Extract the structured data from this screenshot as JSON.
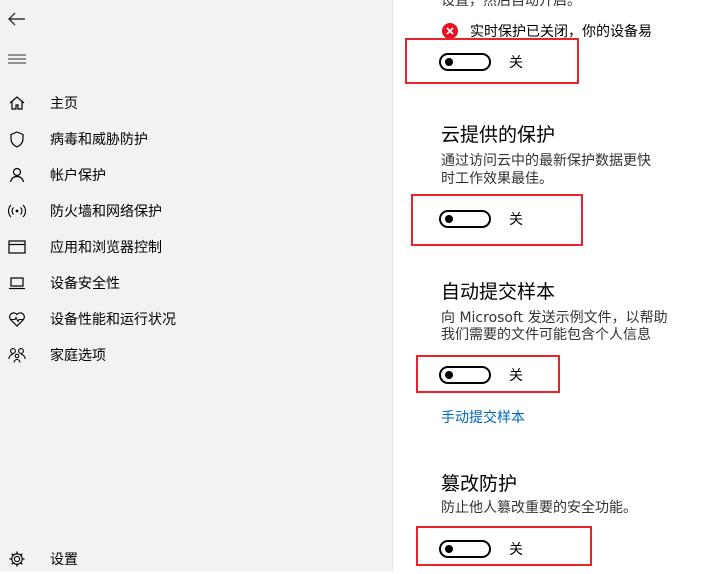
{
  "nav": {
    "items": [
      {
        "icon": "home-icon",
        "label": "主页"
      },
      {
        "icon": "shield-icon",
        "label": "病毒和威胁防护"
      },
      {
        "icon": "person-icon",
        "label": "帐户保护"
      },
      {
        "icon": "network-icon",
        "label": "防火墙和网络保护"
      },
      {
        "icon": "app-browser-icon",
        "label": "应用和浏览器控制"
      },
      {
        "icon": "laptop-icon",
        "label": "设备安全性"
      },
      {
        "icon": "heart-icon",
        "label": "设备性能和运行状况"
      },
      {
        "icon": "family-icon",
        "label": "家庭选项"
      }
    ],
    "settings_label": "设置"
  },
  "main": {
    "top_cut_text": "设置，然后自动开启。",
    "realtime": {
      "status_text": "实时保护已关闭，你的设备易",
      "toggle_label": "关"
    },
    "cloud": {
      "title": "云提供的保护",
      "desc_line1": "通过访问云中的最新保护数据更快",
      "desc_line2": "时工作效果最佳。",
      "toggle_label": "关"
    },
    "sample": {
      "title": "自动提交样本",
      "desc_line1": "向 Microsoft 发送示例文件，以帮助",
      "desc_line2": "我们需要的文件可能包含个人信息",
      "toggle_label": "关",
      "link": "手动提交样本"
    },
    "tamper": {
      "title": "篡改防护",
      "desc": "防止他人篡改重要的安全功能。",
      "toggle_label": "关"
    }
  },
  "colors": {
    "accent": "#0067c0",
    "error": "#e81123",
    "highlight_box": "#e8232b"
  }
}
